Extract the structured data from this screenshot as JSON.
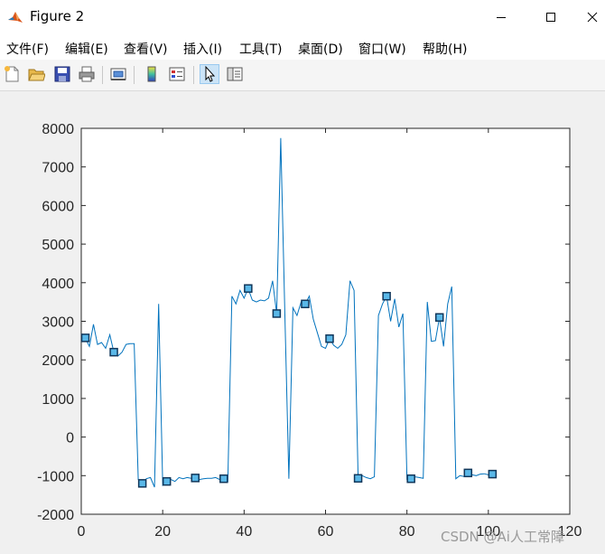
{
  "window": {
    "title": "Figure 2",
    "controls": [
      "minimize",
      "maximize",
      "close"
    ]
  },
  "menu": [
    {
      "label": "文件(F)"
    },
    {
      "label": "编辑(E)"
    },
    {
      "label": "查看(V)"
    },
    {
      "label": "插入(I)"
    },
    {
      "label": "工具(T)"
    },
    {
      "label": "桌面(D)"
    },
    {
      "label": "窗口(W)"
    },
    {
      "label": "帮助(H)"
    }
  ],
  "toolbar": {
    "buttons": [
      "new-figure-icon",
      "open-file-icon",
      "save-icon",
      "print-icon",
      "link-plot-icon",
      "colorbar-icon",
      "legend-icon",
      "pointer-icon",
      "property-editor-icon"
    ],
    "active": "pointer-icon"
  },
  "watermark": "CSDN @Ai人工常障",
  "chart_data": {
    "type": "line",
    "xlim": [
      0,
      120
    ],
    "ylim": [
      -2000,
      8000
    ],
    "xticks": [
      0,
      20,
      40,
      60,
      80,
      100,
      120
    ],
    "yticks": [
      -2000,
      -1000,
      0,
      1000,
      2000,
      3000,
      4000,
      5000,
      6000,
      7000,
      8000
    ],
    "grid": false,
    "line_color": "#0072bd",
    "marker": "square",
    "series": [
      {
        "x": [
          1,
          2,
          3,
          4,
          5,
          6,
          7,
          8,
          9,
          10,
          11,
          12,
          13,
          14,
          15,
          16,
          17,
          18,
          19,
          20,
          21,
          22,
          23,
          24,
          25,
          26,
          27,
          28,
          29,
          30,
          31,
          32,
          33,
          34,
          35,
          36,
          37,
          38,
          39,
          40,
          41,
          42,
          43,
          44,
          45,
          46,
          47,
          48,
          49,
          50,
          51,
          52,
          53,
          54,
          55,
          56,
          57,
          58,
          59,
          60,
          61,
          62,
          63,
          64,
          65,
          66,
          67,
          68,
          69,
          70,
          71,
          72,
          73,
          74,
          75,
          76,
          77,
          78,
          79,
          80,
          81,
          82,
          83,
          84,
          85,
          86,
          87,
          88,
          89,
          90,
          91,
          92,
          93,
          94,
          95,
          96,
          97,
          98,
          99,
          100,
          101
        ],
        "y": [
          2570,
          2350,
          2920,
          2400,
          2450,
          2300,
          2650,
          2200,
          2100,
          2200,
          2400,
          2420,
          2420,
          -1100,
          -1200,
          -1080,
          -1050,
          -1300,
          3450,
          -1250,
          -1150,
          -1100,
          -1150,
          -1050,
          -1080,
          -1050,
          -1070,
          -1060,
          -1100,
          -1080,
          -1070,
          -1070,
          -1050,
          -1100,
          -1080,
          -1150,
          3650,
          3450,
          3800,
          3600,
          3850,
          3550,
          3500,
          3550,
          3530,
          3600,
          4050,
          3200,
          7750,
          3250,
          -1080,
          3350,
          3150,
          3500,
          3450,
          3650,
          3050,
          2700,
          2350,
          2300,
          2550,
          2380,
          2300,
          2400,
          2650,
          4050,
          3800,
          -1070,
          -1000,
          -1050,
          -1080,
          -1030,
          3150,
          3450,
          3650,
          3000,
          3580,
          2850,
          3200,
          -1100,
          -1080,
          -1030,
          -1050,
          -1070,
          3500,
          2480,
          2500,
          3100,
          2350,
          3450,
          3900,
          -1080,
          -1000,
          -1020,
          -930,
          -980,
          -1000,
          -960,
          -950,
          -980,
          -960
        ],
        "marker_indices": [
          0,
          7,
          14,
          20,
          27,
          34,
          40,
          47,
          54,
          60,
          67,
          74,
          80,
          87,
          94,
          100
        ]
      }
    ]
  }
}
